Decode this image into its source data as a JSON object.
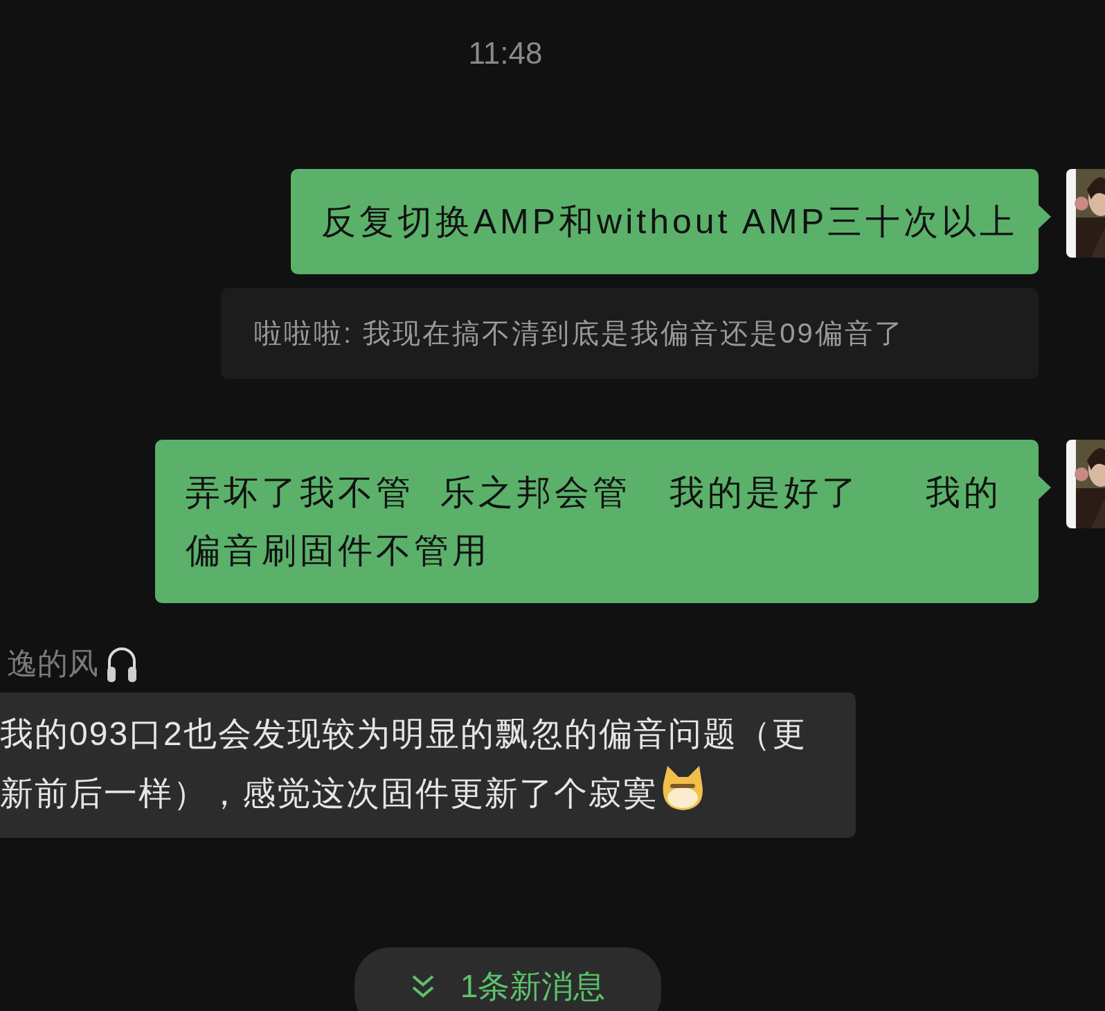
{
  "timestamp": "11:48",
  "messages": [
    {
      "kind": "outgoing",
      "text": "反复切换AMP和without AMP三十次以上",
      "quote": "啦啦啦: 我现在搞不清到底是我偏音还是09偏音了"
    },
    {
      "kind": "outgoing",
      "text": "弄坏了我不管  乐之邦会管   我的是好了     我的偏音刷固件不管用"
    },
    {
      "kind": "incoming",
      "sender": "逸的风",
      "text": "我的093口2也会发现较为明显的飘忽的偏音问题（更新前后一样），感觉这次固件更新了个寂寞"
    }
  ],
  "new_messages": {
    "label": "1条新消息"
  }
}
